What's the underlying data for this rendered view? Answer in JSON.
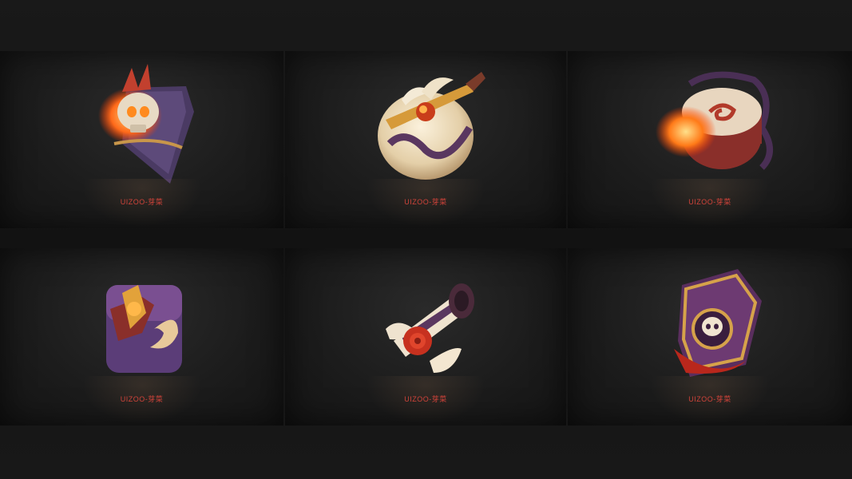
{
  "gallery": {
    "cards": [
      {
        "icon": "skull-shield-icon",
        "caption": "UIZOO-芽菜"
      },
      {
        "icon": "peach-sword-icon",
        "caption": "UIZOO-芽菜"
      },
      {
        "icon": "flame-drum-icon",
        "caption": "UIZOO-芽菜"
      },
      {
        "icon": "treasure-chest-icon",
        "caption": "UIZOO-芽菜"
      },
      {
        "icon": "rose-scroll-icon",
        "caption": "UIZOO-芽菜"
      },
      {
        "icon": "skull-book-icon",
        "caption": "UIZOO-芽菜"
      }
    ]
  },
  "colors": {
    "caption": "#d0433a",
    "background": "#161616"
  }
}
